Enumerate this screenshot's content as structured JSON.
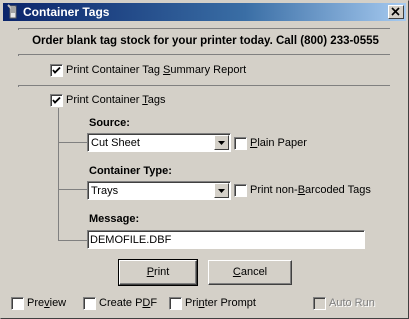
{
  "window": {
    "title": "Container Tags",
    "banner": "Order blank tag stock for your printer today.  Call (800) 233-0555"
  },
  "summary_report": {
    "checked": true,
    "label_pre": "Print Container Tag ",
    "label_ul": "S",
    "label_post": "ummary Report"
  },
  "print_tags": {
    "checked": true,
    "label_pre": "Print Container ",
    "label_ul": "T",
    "label_post": "ags"
  },
  "source": {
    "label": "Source:",
    "value": "Cut Sheet",
    "plain_paper_checked": false,
    "plain_paper_ul": "P",
    "plain_paper_post": "lain Paper"
  },
  "container_type": {
    "label": "Container Type:",
    "value": "Trays",
    "non_barcoded_checked": false,
    "non_barcoded_pre": "Print non-",
    "non_barcoded_ul": "B",
    "non_barcoded_post": "arcoded Tags"
  },
  "message": {
    "label": "Message:",
    "value": "DEMOFILE.DBF"
  },
  "buttons": {
    "print_ul": "P",
    "print_post": "rint",
    "cancel_ul": "C",
    "cancel_post": "ancel"
  },
  "footer": {
    "preview_checked": false,
    "preview_pre": "Pre",
    "preview_ul": "v",
    "preview_post": "iew",
    "create_pdf_checked": false,
    "create_pdf_pre": "Create P",
    "create_pdf_ul": "D",
    "create_pdf_post": "F",
    "printer_prompt_checked": false,
    "printer_prompt_pre": "Pri",
    "printer_prompt_ul": "n",
    "printer_prompt_post": "ter Prompt",
    "auto_run_checked": false,
    "auto_run_label": "Auto Run",
    "auto_run_disabled": true
  }
}
